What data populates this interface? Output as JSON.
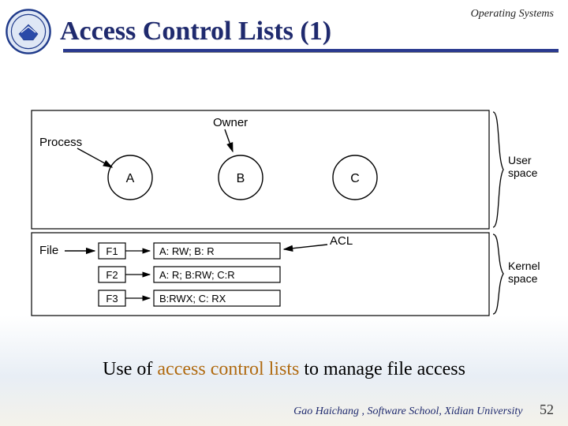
{
  "header": {
    "title": "Access Control Lists (1)",
    "course": "Operating Systems"
  },
  "diagram": {
    "labels": {
      "process": "Process",
      "owner": "Owner",
      "file": "File",
      "acl": "ACL",
      "user_space": "User space",
      "kernel_space": "Kernel space"
    },
    "processes": {
      "A": "A",
      "B": "B",
      "C": "C"
    },
    "files": {
      "F1": "F1",
      "F2": "F2",
      "F3": "F3"
    },
    "acl_rows": {
      "F1": "A: RW;   B: R",
      "F2": "A: R;   B:RW;   C:R",
      "F3": "B:RWX;   C: RX"
    }
  },
  "caption": {
    "pre": "Use of ",
    "hl": "access control lists",
    "post": " to manage file access"
  },
  "footer": {
    "credit": "Gao Haichang , Software School, Xidian University",
    "page": "52"
  }
}
